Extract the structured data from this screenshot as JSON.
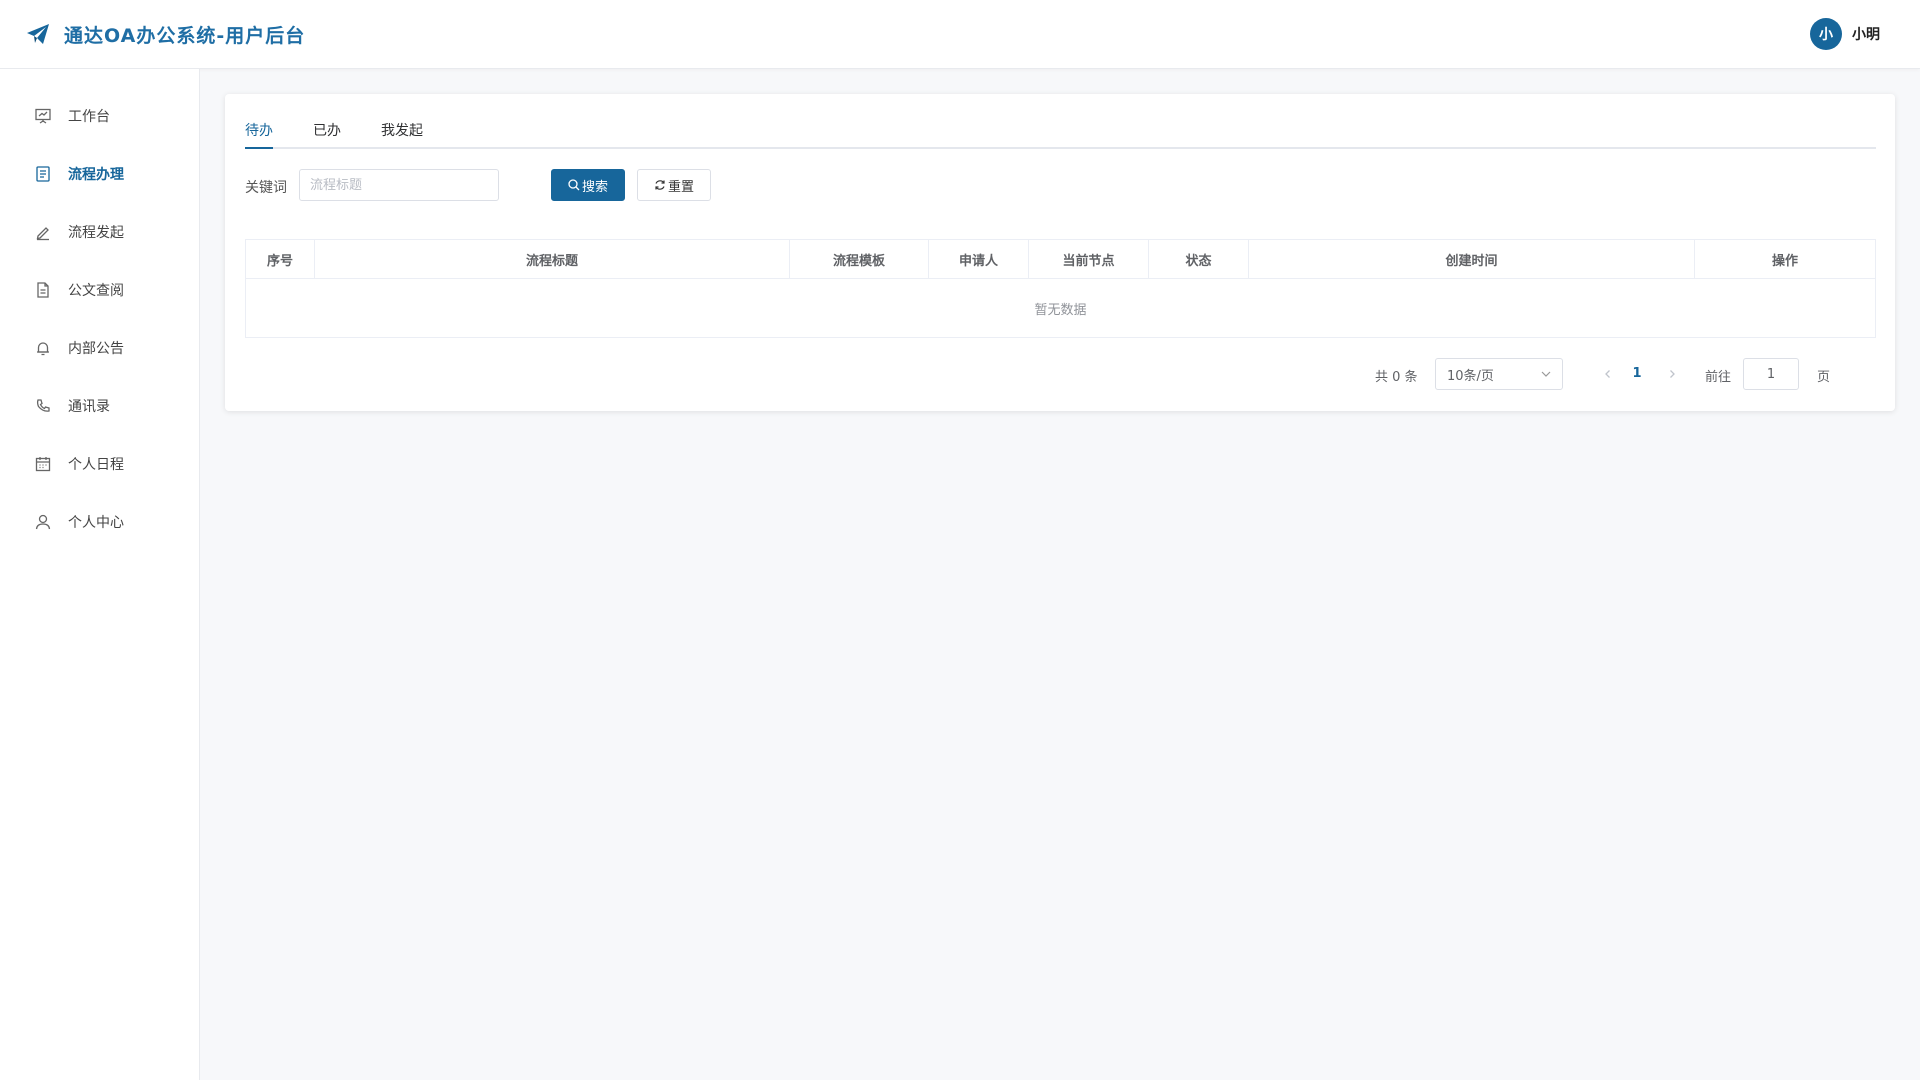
{
  "app": {
    "title": "通达OA办公系统-用户后台",
    "brand_color": "#17669b"
  },
  "user": {
    "avatar_text": "小",
    "name": "小明"
  },
  "sidebar": {
    "items": [
      {
        "label": "工作台",
        "icon": "presentation-board-icon",
        "active": false
      },
      {
        "label": "流程办理",
        "icon": "document-list-icon",
        "active": true
      },
      {
        "label": "流程发起",
        "icon": "pen-icon",
        "active": false
      },
      {
        "label": "公文查阅",
        "icon": "file-text-icon",
        "active": false
      },
      {
        "label": "内部公告",
        "icon": "bell-icon",
        "active": false
      },
      {
        "label": "通讯录",
        "icon": "phone-icon",
        "active": false
      },
      {
        "label": "个人日程",
        "icon": "calendar-icon",
        "active": false
      },
      {
        "label": "个人中心",
        "icon": "user-icon",
        "active": false
      }
    ]
  },
  "tabs": [
    {
      "label": "待办",
      "active": true
    },
    {
      "label": "已办",
      "active": false
    },
    {
      "label": "我发起",
      "active": false
    }
  ],
  "filter": {
    "keyword_label": "关键词",
    "keyword_placeholder": "流程标题",
    "search_label": "搜索",
    "reset_label": "重置"
  },
  "table": {
    "columns": [
      "序号",
      "流程标题",
      "流程模板",
      "申请人",
      "当前节点",
      "状态",
      "创建时间",
      "操作"
    ],
    "rows": [],
    "empty_text": "暂无数据"
  },
  "pagination": {
    "total_text": "共 0 条",
    "page_size": "10条/页",
    "current_page": "1",
    "goto_label": "前往",
    "goto_value": "1",
    "page_unit": "页"
  }
}
